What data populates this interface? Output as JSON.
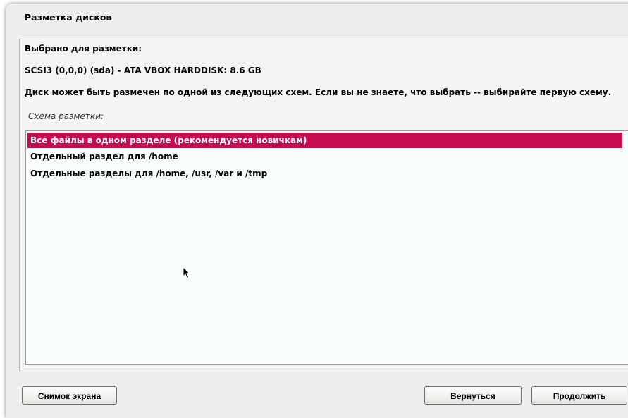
{
  "window": {
    "title": "Разметка дисков"
  },
  "content": {
    "selected_label": "Выбрано для разметки:",
    "disk_name": "SCSI3 (0,0,0) (sda) - ATA VBOX HARDDISK: 8.6 GB",
    "description": "Диск может быть размечен по одной из следующих схем. Если вы не знаете, что выбрать -- выбирайте первую схему.",
    "scheme_label": "Схема разметки:"
  },
  "list": {
    "items": [
      {
        "label": "Все файлы в одном разделе (рекомендуется новичкам)",
        "selected": true
      },
      {
        "label": "Отдельный раздел для /home",
        "selected": false
      },
      {
        "label": "Отдельные разделы для /home, /usr, /var и /tmp",
        "selected": false
      }
    ]
  },
  "buttons": {
    "screenshot": "Снимок экрана",
    "back": "Вернуться",
    "continue": "Продолжить"
  },
  "colors": {
    "selection": "#c50c4f",
    "background": "#eeeeec",
    "list_background": "#f8fdf9"
  }
}
